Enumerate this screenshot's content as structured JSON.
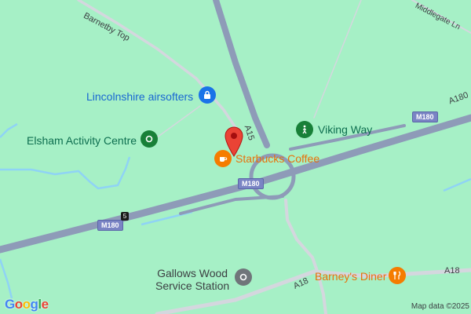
{
  "map": {
    "background_color": "#a6f0c6",
    "road_color": "#8e9bb8",
    "minor_road_color": "#d4d7de",
    "water_color": "#8fd3f5"
  },
  "roads": {
    "barnetby_top": "Barnetby Top",
    "middlegate_ln": "Middlegate Ln",
    "a15": "A15",
    "a180": "A180",
    "a18_west": "A18",
    "a18_east": "A18"
  },
  "shields": {
    "m180_left": "M180",
    "m180_center": "M180",
    "m180_right": "M180",
    "junction": "5"
  },
  "pois": {
    "lincolnshire_airsofters": "Lincolnshire airsofters",
    "elsham_activity_centre": "Elsham Activity Centre",
    "viking_way": "Viking Way",
    "starbucks": "Starbucks Coffee",
    "gallows_wood_line1": "Gallows Wood",
    "gallows_wood_line2": "Service Station",
    "barneys_diner": "Barney's Diner"
  },
  "footer": {
    "attribution": "Map data ©2025"
  }
}
